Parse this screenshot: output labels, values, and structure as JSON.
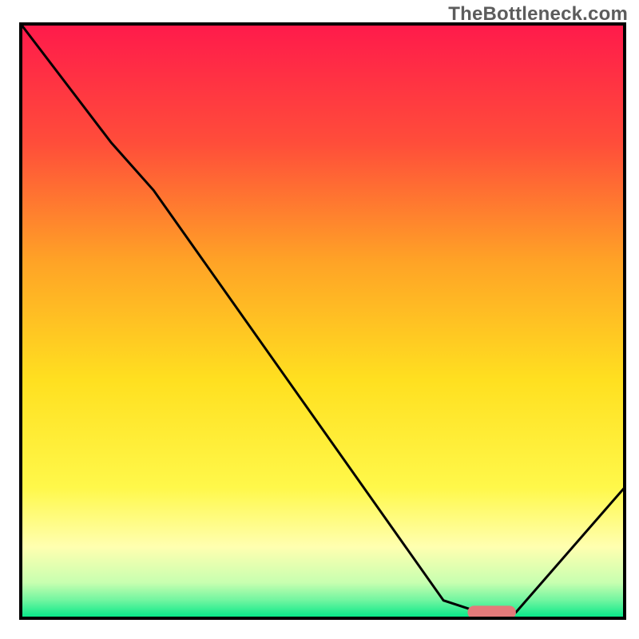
{
  "watermark": "TheBottleneck.com",
  "chart_data": {
    "type": "line",
    "title": "",
    "xlabel": "",
    "ylabel": "",
    "xlim": [
      0,
      100
    ],
    "ylim": [
      0,
      100
    ],
    "grid": false,
    "background_gradient": {
      "stops": [
        {
          "pos": 0.0,
          "color": "#ff1a4b"
        },
        {
          "pos": 0.2,
          "color": "#ff4d3a"
        },
        {
          "pos": 0.4,
          "color": "#ffa326"
        },
        {
          "pos": 0.6,
          "color": "#ffe020"
        },
        {
          "pos": 0.78,
          "color": "#fff84a"
        },
        {
          "pos": 0.88,
          "color": "#ffffb0"
        },
        {
          "pos": 0.94,
          "color": "#c8ffb0"
        },
        {
          "pos": 0.97,
          "color": "#70f5a0"
        },
        {
          "pos": 1.0,
          "color": "#00e888"
        }
      ]
    },
    "series": [
      {
        "name": "bottleneck-curve",
        "color": "#000000",
        "x": [
          0,
          15,
          22,
          70,
          76,
          82,
          100
        ],
        "y": [
          100,
          80,
          72,
          3,
          1,
          1,
          22
        ]
      }
    ],
    "marker": {
      "name": "optimal-range",
      "shape": "rounded-bar",
      "color": "#e37a7a",
      "x_start": 74,
      "x_end": 82,
      "y": 1,
      "thickness": 2.2
    }
  }
}
